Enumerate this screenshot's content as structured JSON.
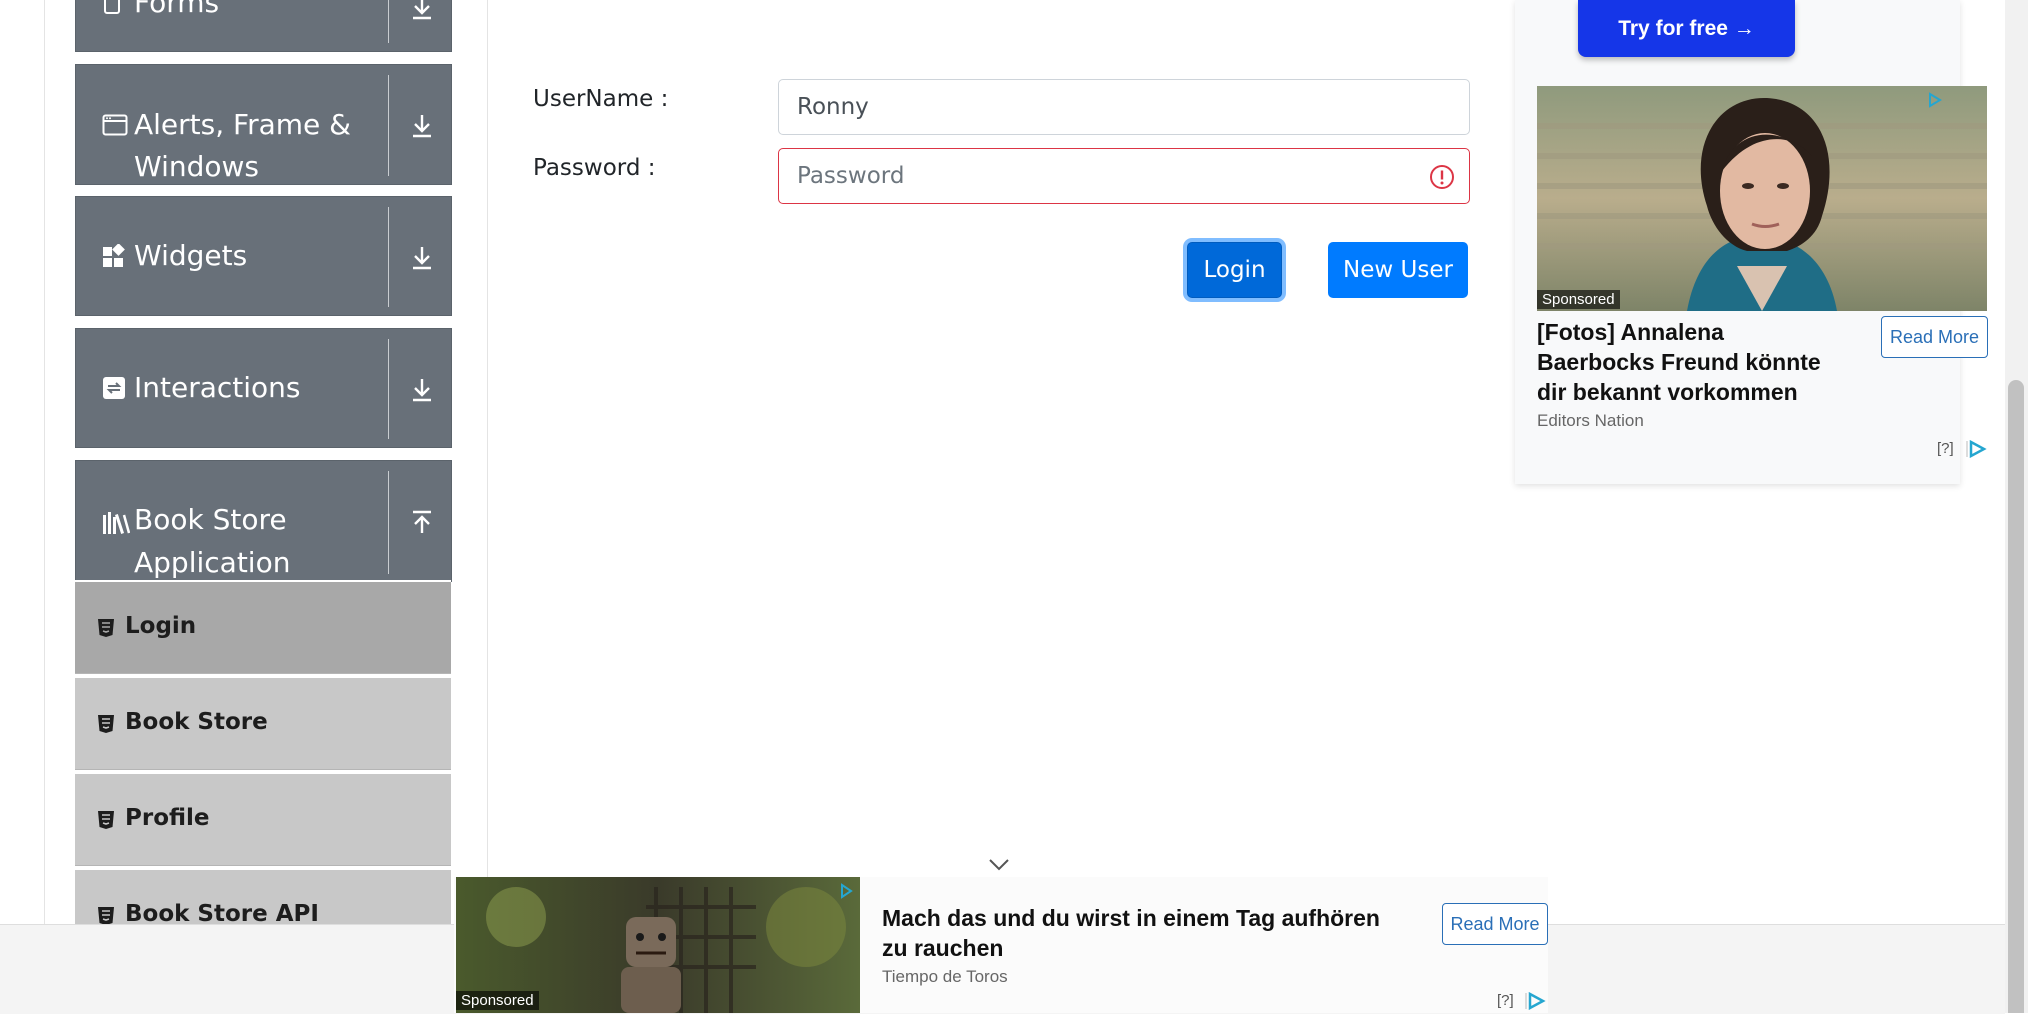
{
  "sidebar": {
    "groups": [
      {
        "title": "Forms",
        "icon": "form-icon",
        "arrow": "download-arrow-icon"
      },
      {
        "title_line1": "Alerts, Frame &",
        "title_line2": "Windows",
        "icon": "window-icon",
        "arrow": "download-arrow-icon"
      },
      {
        "title": "Widgets",
        "icon": "widgets-icon",
        "arrow": "download-arrow-icon"
      },
      {
        "title": "Interactions",
        "icon": "interactions-icon",
        "arrow": "download-arrow-icon"
      },
      {
        "title_line1": "Book Store",
        "title_line2": "Application",
        "icon": "books-icon",
        "arrow": "upload-arrow-icon"
      }
    ],
    "items": [
      {
        "label": "Login",
        "active": true
      },
      {
        "label": "Book Store"
      },
      {
        "label": "Profile"
      },
      {
        "label": "Book Store API"
      }
    ]
  },
  "form": {
    "username_label": "UserName :",
    "username_value": "Ronny",
    "password_label": "Password :",
    "password_placeholder": "Password",
    "login_button": "Login",
    "new_user_button": "New User"
  },
  "ad_right": {
    "cta": "Try for free →",
    "sponsored": "Sponsored",
    "title": "[Fotos] Annalena Baerbocks Freund könnte dir bekannt vorkommen",
    "title_line1": "[Fotos] Annalena",
    "title_line2": "Baerbocks Freund könnte",
    "title_line3": "dir bekannt vorkommen",
    "source": "Editors Nation",
    "read_more": "Read More",
    "adchoice": "[?]"
  },
  "ad_bottom": {
    "sponsored": "Sponsored",
    "title_line1": "Mach das und du wirst in einem Tag aufhören",
    "title_line2": "zu rauchen",
    "source": "Tiempo de Toros",
    "read_more": "Read More",
    "adchoice": "[?]"
  },
  "colors": {
    "sidebar_group": "#687079",
    "menu_item": "#c8c8c8",
    "menu_item_active": "#a8a8a8",
    "primary": "#007bff",
    "invalid": "#dc3545",
    "try_button": "#1536e8"
  }
}
